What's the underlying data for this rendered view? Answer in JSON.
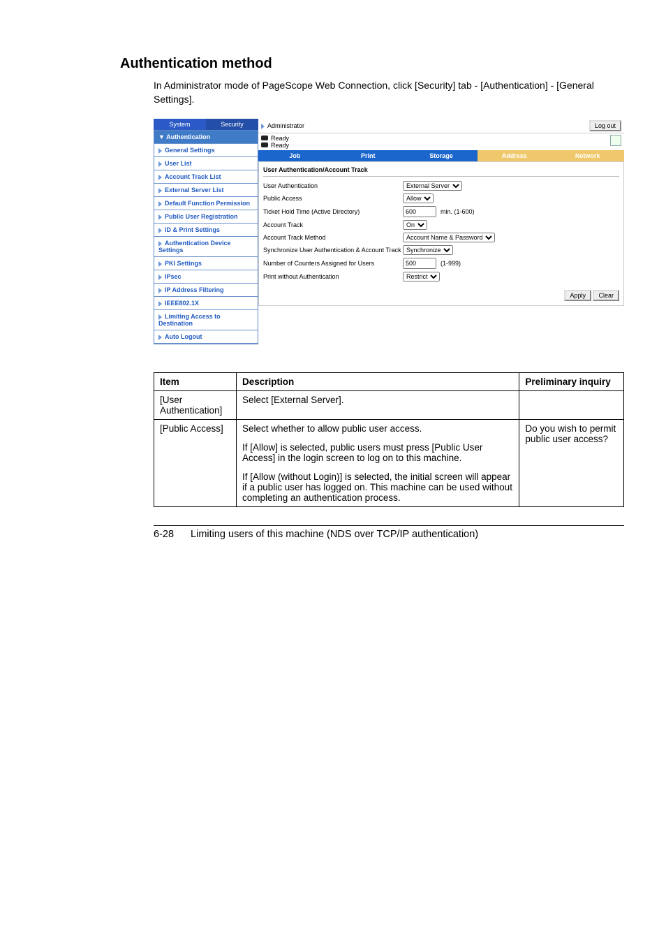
{
  "heading": "Authentication method",
  "intro": "In Administrator mode of PageScope Web Connection, click [Security] tab - [Authentication] - [General Settings].",
  "admin": {
    "label": "Administrator",
    "logout": "Log out",
    "ready1": "Ready",
    "ready2": "Ready"
  },
  "side": {
    "tabs": {
      "system": "System",
      "security": "Security"
    },
    "items": [
      {
        "label": "Authentication",
        "name": "sidebar-item-authentication",
        "group": true
      },
      {
        "label": "General Settings",
        "name": "sidebar-item-general-settings"
      },
      {
        "label": "User List",
        "name": "sidebar-item-user-list"
      },
      {
        "label": "Account Track List",
        "name": "sidebar-item-account-track-list"
      },
      {
        "label": "External Server List",
        "name": "sidebar-item-external-server-list"
      },
      {
        "label": "Default Function Permission",
        "name": "sidebar-item-default-permission"
      },
      {
        "label": "Public User Registration",
        "name": "sidebar-item-public-user-registration"
      },
      {
        "label": "ID & Print Settings",
        "name": "sidebar-item-id-print-settings"
      },
      {
        "label": "Authentication Device Settings",
        "name": "sidebar-item-auth-device-settings"
      },
      {
        "label": "PKI Settings",
        "name": "sidebar-item-pki-settings"
      },
      {
        "label": "IPsec",
        "name": "sidebar-item-ipsec"
      },
      {
        "label": "IP Address Filtering",
        "name": "sidebar-item-ip-filtering"
      },
      {
        "label": "IEEE802.1X",
        "name": "sidebar-item-ieee8021x"
      },
      {
        "label": "Limiting Access to Destination",
        "name": "sidebar-item-limiting-access"
      },
      {
        "label": "Auto Logout",
        "name": "sidebar-item-auto-logout"
      }
    ]
  },
  "navtabs": [
    "Job",
    "Print",
    "Storage",
    "Address",
    "Network"
  ],
  "form": {
    "title": "User Authentication/Account Track",
    "rows": [
      {
        "label": "User Authentication",
        "value": "External Server",
        "type": "select",
        "name": "user-authentication-select"
      },
      {
        "label": "Public Access",
        "value": "Allow",
        "type": "select",
        "name": "public-access-select"
      },
      {
        "label": "Ticket Hold Time (Active Directory)",
        "value": "600",
        "suffix": "min. (1-600)",
        "type": "text",
        "name": "ticket-hold-input"
      },
      {
        "label": "Account Track",
        "value": "On",
        "type": "select",
        "name": "account-track-select"
      },
      {
        "label": "Account Track Method",
        "value": "Account Name & Password",
        "type": "select",
        "name": "account-track-method-select"
      },
      {
        "label": "Synchronize User Authentication & Account Track",
        "value": "Synchronize",
        "type": "select",
        "name": "synchronize-select"
      },
      {
        "label": "Number of Counters Assigned for Users",
        "value": "500",
        "suffix": "(1-999)",
        "type": "text",
        "name": "counters-input"
      },
      {
        "label": "Print without Authentication",
        "value": "Restrict",
        "type": "select",
        "name": "print-without-auth-select"
      }
    ],
    "apply": "Apply",
    "clear": "Clear"
  },
  "table": {
    "headers": [
      "Item",
      "Description",
      "Preliminary inquiry"
    ],
    "rows": [
      {
        "item": "[User Authentication]",
        "desc": [
          "Select [External Server]."
        ],
        "inquiry": ""
      },
      {
        "item": "[Public Access]",
        "desc": [
          "Select whether to allow public user access.",
          "If [Allow] is selected, public users must press [Public User Access] in the login screen to log on to this machine.",
          "If [Allow (without Login)] is selected, the initial screen will appear if a public user has logged on. This machine can be used without completing an authentication process."
        ],
        "inquiry": "Do you wish to permit public user access?"
      }
    ]
  },
  "footer": {
    "page": "6-28",
    "text": "Limiting users of this machine (NDS over TCP/IP authentication)"
  }
}
